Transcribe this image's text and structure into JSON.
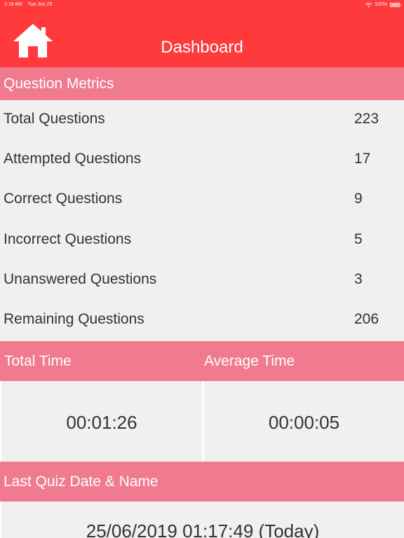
{
  "status_bar": {
    "time": "1:18 AM",
    "date": "Tue Jun 25",
    "battery": "100%"
  },
  "nav": {
    "title": "Dashboard",
    "home_icon": "home-icon"
  },
  "question_metrics": {
    "header": "Question Metrics",
    "rows": [
      {
        "label": "Total Questions",
        "value": "223"
      },
      {
        "label": "Attempted Questions",
        "value": "17"
      },
      {
        "label": "Correct Questions",
        "value": "9"
      },
      {
        "label": "Incorrect Questions",
        "value": "5"
      },
      {
        "label": "Unanswered Questions",
        "value": "3"
      },
      {
        "label": "Remaining Questions",
        "value": "206"
      }
    ]
  },
  "time_metrics": {
    "total_label": "Total Time",
    "total_value": "00:01:26",
    "average_label": "Average Time",
    "average_value": "00:00:05"
  },
  "last_quiz": {
    "header": "Last Quiz Date & Name",
    "value": "25/06/2019 01:17:49 (Today)"
  },
  "colors": {
    "nav_bar": "#ff3a3c",
    "section_header": "#f07b8f",
    "body_bg": "#f0f0f0",
    "text": "#333333"
  }
}
